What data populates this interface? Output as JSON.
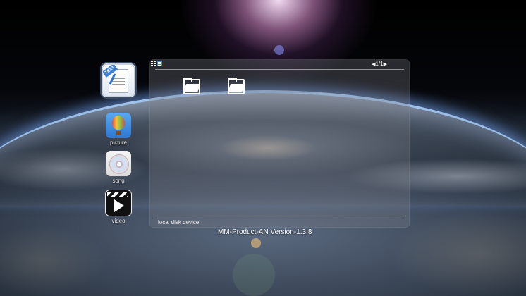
{
  "dock": [
    {
      "label": "",
      "icon": "text-document-icon"
    },
    {
      "label": "picture",
      "icon": "hot-air-balloon-icon"
    },
    {
      "label": "song",
      "icon": "music-disc-icon"
    },
    {
      "label": "video",
      "icon": "clapperboard-play-icon"
    }
  ],
  "panel": {
    "view_icons": [
      "grid-view-icon",
      "list-view-icon"
    ],
    "pager": {
      "prev": "◀",
      "text": "1/1",
      "next": "▶"
    },
    "folders": [
      {
        "icon": "folder-icon"
      },
      {
        "icon": "folder-icon"
      }
    ],
    "location_label": "local disk device"
  },
  "footer": {
    "version": "MM-Product-AN Version-1.3.8"
  },
  "colors": {
    "accent": "#3c8de6",
    "text": "#ffffff"
  }
}
